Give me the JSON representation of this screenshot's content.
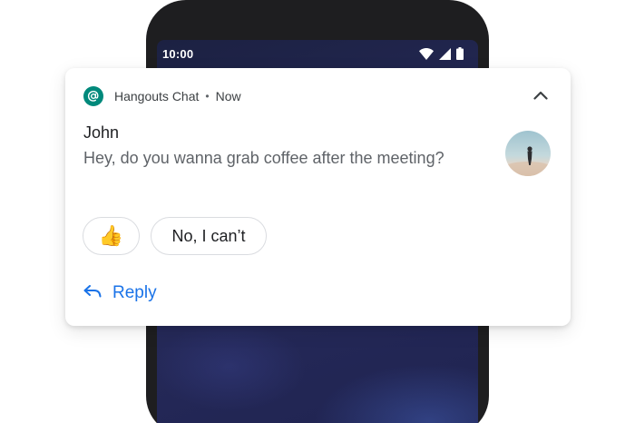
{
  "status_bar": {
    "time": "10:00",
    "icons": [
      "wifi-icon",
      "cellular-signal-icon",
      "battery-icon"
    ]
  },
  "notification": {
    "app_icon": "hangouts-chat-icon",
    "app_name": "Hangouts Chat",
    "separator": "•",
    "time": "Now",
    "sender": "John",
    "message": "Hey, do you wanna grab coffee after the meeting?",
    "smart_replies": [
      "👍",
      "No, I can’t"
    ],
    "reply_label": "Reply"
  },
  "colors": {
    "app_icon": "#00897b",
    "accent": "#1a73e8",
    "phone_body": "#1e1e20",
    "wallpaper": "#262a5a"
  }
}
